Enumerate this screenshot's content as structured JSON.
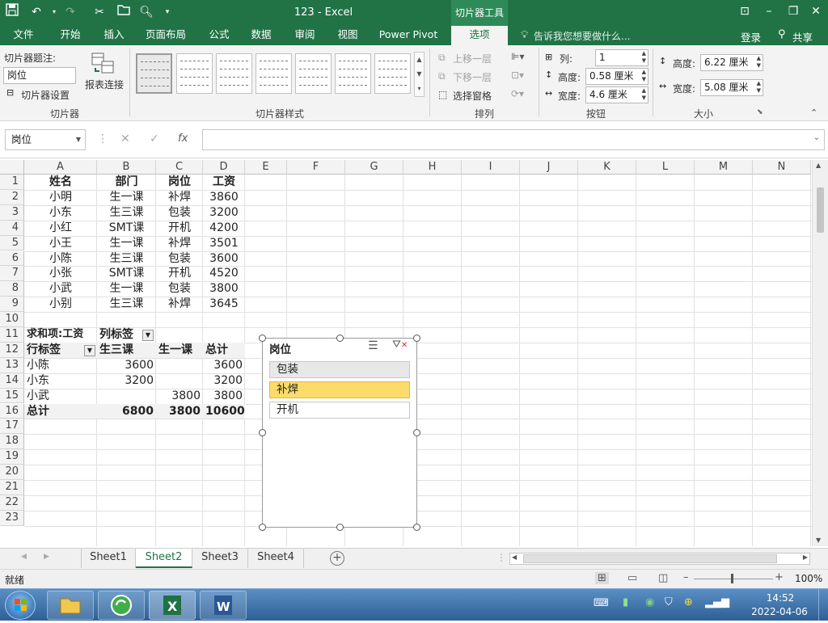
{
  "window": {
    "title": "123 - Excel",
    "context_tab": "切片器工具"
  },
  "ribbon_tabs": [
    "文件",
    "开始",
    "插入",
    "页面布局",
    "公式",
    "数据",
    "审阅",
    "视图",
    "Power Pivot",
    "选项"
  ],
  "tell_me": "告诉我您想要做什么...",
  "account": {
    "login": "登录",
    "share": "共享"
  },
  "ribbon": {
    "caption_label": "切片器题注:",
    "caption_value": "岗位",
    "slicer_settings": "切片器设置",
    "report_connections": "报表连接",
    "group_slicer": "切片器",
    "group_styles": "切片器样式",
    "bring_forward": "上移一层",
    "send_backward": "下移一层",
    "selection_pane": "选择窗格",
    "group_arrange": "排列",
    "columns_label": "列:",
    "columns_value": "1",
    "btn_height_label": "高度:",
    "btn_height_value": "0.58 厘米",
    "btn_width_label": "宽度:",
    "btn_width_value": "4.6 厘米",
    "group_buttons": "按钮",
    "size_height_label": "高度:",
    "size_height_value": "6.22 厘米",
    "size_width_label": "宽度:",
    "size_width_value": "5.08 厘米",
    "group_size": "大小"
  },
  "formula_bar": {
    "name_box": "岗位",
    "fx": "fx",
    "content": ""
  },
  "columns": [
    "A",
    "B",
    "C",
    "D",
    "E",
    "F",
    "G",
    "H",
    "I",
    "J",
    "K",
    "L",
    "M",
    "N"
  ],
  "rows": [
    "1",
    "2",
    "3",
    "4",
    "5",
    "6",
    "7",
    "8",
    "9",
    "10",
    "11",
    "12",
    "13",
    "14",
    "15",
    "16",
    "17",
    "18",
    "19",
    "20",
    "21",
    "22",
    "23"
  ],
  "table": {
    "headers": [
      "姓名",
      "部门",
      "岗位",
      "工资"
    ],
    "rows": [
      [
        "小明",
        "生一课",
        "补焊",
        "3860"
      ],
      [
        "小东",
        "生三课",
        "包装",
        "3200"
      ],
      [
        "小红",
        "SMT课",
        "开机",
        "4200"
      ],
      [
        "小王",
        "生一课",
        "补焊",
        "3501"
      ],
      [
        "小陈",
        "生三课",
        "包装",
        "3600"
      ],
      [
        "小张",
        "SMT课",
        "开机",
        "4520"
      ],
      [
        "小武",
        "生一课",
        "包装",
        "3800"
      ],
      [
        "小别",
        "生三课",
        "补焊",
        "3645"
      ]
    ]
  },
  "pivot": {
    "sum_label": "求和项:工资",
    "col_label": "列标签",
    "row_label": "行标签",
    "col_headers": [
      "生三课",
      "生一课",
      "总计"
    ],
    "rows": [
      [
        "小陈",
        "3600",
        "",
        "3600"
      ],
      [
        "小东",
        "3200",
        "",
        "3200"
      ],
      [
        "小武",
        "",
        "3800",
        "3800"
      ]
    ],
    "total": [
      "总计",
      "6800",
      "3800",
      "10600"
    ]
  },
  "slicer": {
    "title": "岗位",
    "items": [
      "包装",
      "补焊",
      "开机"
    ],
    "selected": "补焊"
  },
  "sheets": [
    "Sheet1",
    "Sheet2",
    "Sheet3",
    "Sheet4"
  ],
  "active_sheet": "Sheet2",
  "status": {
    "ready": "就绪",
    "zoom": "100%"
  },
  "clock": {
    "time": "14:52",
    "date": "2022-04-06"
  },
  "colors": {
    "accent": "#217346",
    "slicer_selected": "#fbdc6a"
  }
}
